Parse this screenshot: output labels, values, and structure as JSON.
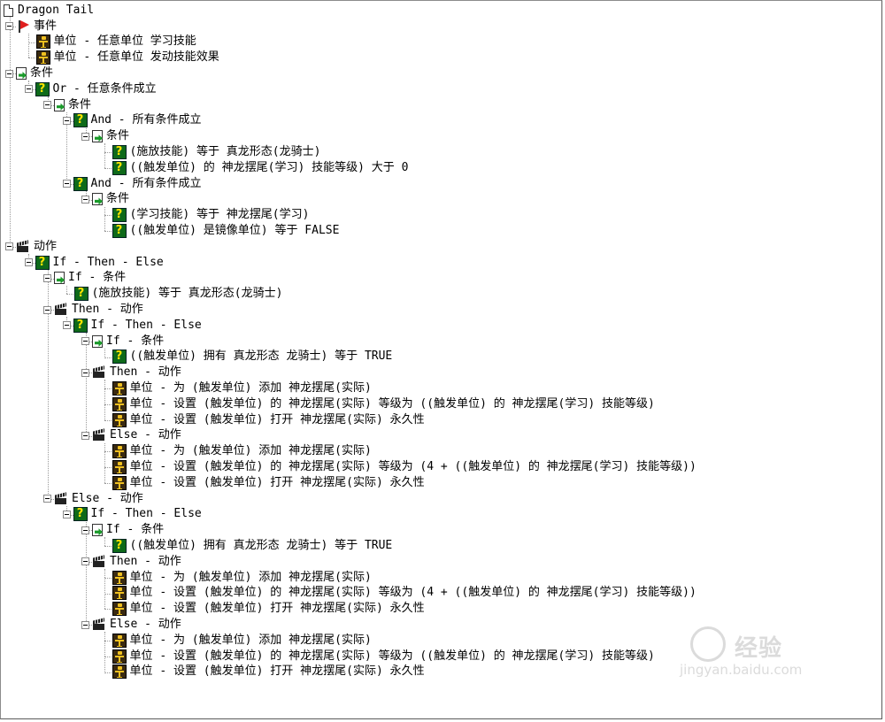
{
  "window": {
    "title": "Dragon Tail"
  },
  "tree": [
    {
      "depth": 0,
      "icon": "document-icon",
      "label": "Dragon Tail",
      "toggle": false
    },
    {
      "depth": 0,
      "icon": "event-flag-icon",
      "label": "事件",
      "toggle": true
    },
    {
      "depth": 1,
      "icon": "unit-icon",
      "label": "单位 - 任意单位 学习技能",
      "toggle": false
    },
    {
      "depth": 1,
      "icon": "unit-icon",
      "label": "单位 - 任意单位 发动技能效果",
      "toggle": false
    },
    {
      "depth": 0,
      "icon": "condition-icon",
      "label": "条件",
      "toggle": true
    },
    {
      "depth": 1,
      "icon": "question-icon",
      "label": "Or - 任意条件成立",
      "toggle": true
    },
    {
      "depth": 2,
      "icon": "condition-icon",
      "label": "条件",
      "toggle": true
    },
    {
      "depth": 3,
      "icon": "question-icon",
      "label": "And - 所有条件成立",
      "toggle": true
    },
    {
      "depth": 4,
      "icon": "condition-icon",
      "label": "条件",
      "toggle": true
    },
    {
      "depth": 5,
      "icon": "question-icon",
      "label": "(施放技能) 等于 真龙形态(龙骑士)",
      "toggle": false
    },
    {
      "depth": 5,
      "icon": "question-icon",
      "label": "((触发单位) 的 神龙摆尾(学习)  技能等级) 大于 0",
      "toggle": false
    },
    {
      "depth": 3,
      "icon": "question-icon",
      "label": "And - 所有条件成立",
      "toggle": true
    },
    {
      "depth": 4,
      "icon": "condition-icon",
      "label": "条件",
      "toggle": true
    },
    {
      "depth": 5,
      "icon": "question-icon",
      "label": "(学习技能) 等于 神龙摆尾(学习)",
      "toggle": false
    },
    {
      "depth": 5,
      "icon": "question-icon",
      "label": "((触发单位) 是镜像单位) 等于 FALSE",
      "toggle": false
    },
    {
      "depth": 0,
      "icon": "action-icon",
      "label": "动作",
      "toggle": true
    },
    {
      "depth": 1,
      "icon": "question-icon",
      "label": "If - Then - Else",
      "toggle": true
    },
    {
      "depth": 2,
      "icon": "condition-icon",
      "label": "If - 条件",
      "toggle": true
    },
    {
      "depth": 3,
      "icon": "question-icon",
      "label": "(施放技能) 等于 真龙形态(龙骑士)",
      "toggle": false
    },
    {
      "depth": 2,
      "icon": "action-icon",
      "label": "Then - 动作",
      "toggle": true
    },
    {
      "depth": 3,
      "icon": "question-icon",
      "label": "If - Then - Else",
      "toggle": true
    },
    {
      "depth": 4,
      "icon": "condition-icon",
      "label": "If - 条件",
      "toggle": true
    },
    {
      "depth": 5,
      "icon": "question-icon",
      "label": "((触发单位) 拥有 真龙形态 龙骑士) 等于 TRUE",
      "toggle": false
    },
    {
      "depth": 4,
      "icon": "action-icon",
      "label": "Then - 动作",
      "toggle": true
    },
    {
      "depth": 5,
      "icon": "unit-icon",
      "label": "单位 - 为 (触发单位) 添加 神龙摆尾(实际)",
      "toggle": false
    },
    {
      "depth": 5,
      "icon": "unit-icon",
      "label": "单位 - 设置 (触发单位) 的 神龙摆尾(实际)  等级为 ((触发单位) 的 神龙摆尾(学习)  技能等级)",
      "toggle": false
    },
    {
      "depth": 5,
      "icon": "unit-icon",
      "label": "单位 - 设置 (触发单位) 打开 神龙摆尾(实际)  永久性",
      "toggle": false
    },
    {
      "depth": 4,
      "icon": "action-icon",
      "label": "Else - 动作",
      "toggle": true
    },
    {
      "depth": 5,
      "icon": "unit-icon",
      "label": "单位 - 为 (触发单位) 添加 神龙摆尾(实际)",
      "toggle": false
    },
    {
      "depth": 5,
      "icon": "unit-icon",
      "label": "单位 - 设置 (触发单位) 的 神龙摆尾(实际)  等级为 (4 + ((触发单位) 的 神龙摆尾(学习)  技能等级))",
      "toggle": false
    },
    {
      "depth": 5,
      "icon": "unit-icon",
      "label": "单位 - 设置 (触发单位) 打开 神龙摆尾(实际)  永久性",
      "toggle": false
    },
    {
      "depth": 2,
      "icon": "action-icon",
      "label": "Else - 动作",
      "toggle": true
    },
    {
      "depth": 3,
      "icon": "question-icon",
      "label": "If - Then - Else",
      "toggle": true
    },
    {
      "depth": 4,
      "icon": "condition-icon",
      "label": "If - 条件",
      "toggle": true
    },
    {
      "depth": 5,
      "icon": "question-icon",
      "label": "((触发单位) 拥有 真龙形态 龙骑士) 等于 TRUE",
      "toggle": false
    },
    {
      "depth": 4,
      "icon": "action-icon",
      "label": "Then - 动作",
      "toggle": true
    },
    {
      "depth": 5,
      "icon": "unit-icon",
      "label": "单位 - 为 (触发单位) 添加 神龙摆尾(实际)",
      "toggle": false
    },
    {
      "depth": 5,
      "icon": "unit-icon",
      "label": "单位 - 设置 (触发单位) 的 神龙摆尾(实际)  等级为 (4 + ((触发单位) 的 神龙摆尾(学习)  技能等级))",
      "toggle": false
    },
    {
      "depth": 5,
      "icon": "unit-icon",
      "label": "单位 - 设置 (触发单位) 打开 神龙摆尾(实际)  永久性",
      "toggle": false
    },
    {
      "depth": 4,
      "icon": "action-icon",
      "label": "Else - 动作",
      "toggle": true
    },
    {
      "depth": 5,
      "icon": "unit-icon",
      "label": "单位 - 为 (触发单位) 添加 神龙摆尾(实际)",
      "toggle": false
    },
    {
      "depth": 5,
      "icon": "unit-icon",
      "label": "单位 - 设置 (触发单位) 的 神龙摆尾(实际)  等级为 ((触发单位) 的 神龙摆尾(学习)  技能等级)",
      "toggle": false
    },
    {
      "depth": 5,
      "icon": "unit-icon",
      "label": "单位 - 设置 (触发单位) 打开 神龙摆尾(实际)  永久性",
      "toggle": false
    }
  ],
  "watermark": {
    "brand": "经验",
    "url": "jingyan.baidu.com"
  }
}
